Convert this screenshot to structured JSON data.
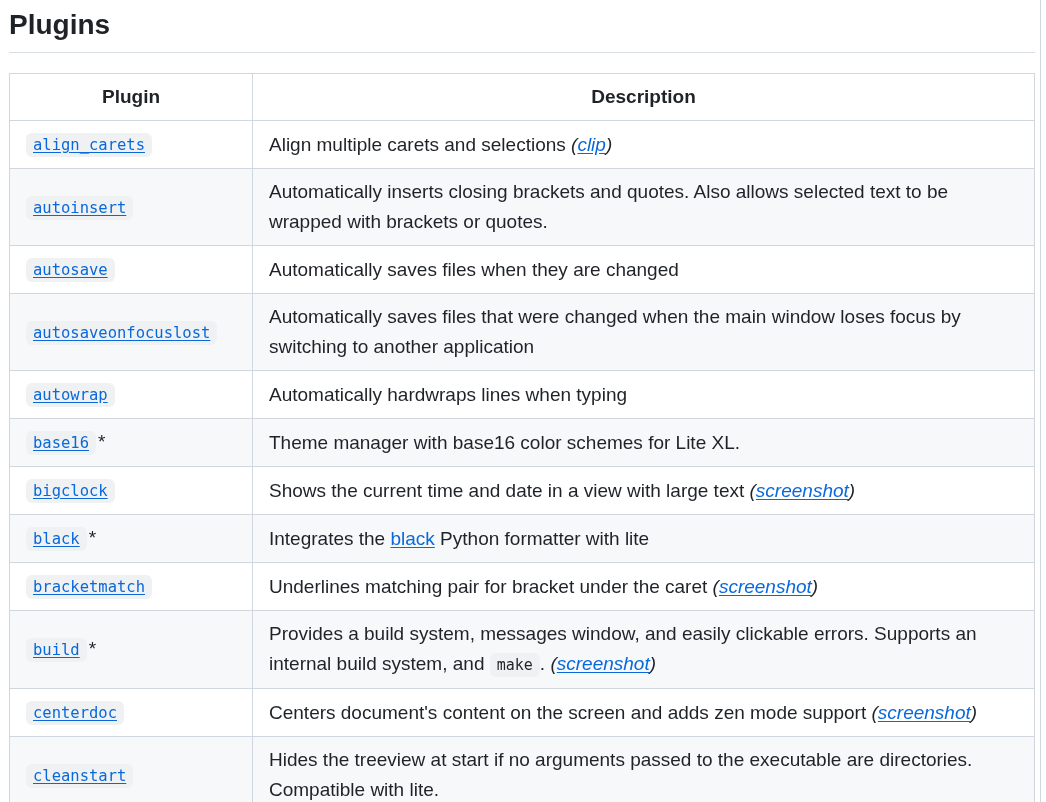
{
  "heading": "Plugins",
  "table": {
    "columns": [
      "Plugin",
      "Description"
    ],
    "rows": [
      {
        "plugin": [
          {
            "kind": "code_link",
            "text": "align_carets"
          }
        ],
        "description": [
          {
            "kind": "text",
            "text": "Align multiple carets and selections *(*"
          },
          {
            "kind": "link",
            "text": "clip",
            "italic": true
          },
          {
            "kind": "text",
            "text": "*)*"
          }
        ]
      },
      {
        "plugin": [
          {
            "kind": "code_link",
            "text": "autoinsert"
          }
        ],
        "description": [
          {
            "kind": "text",
            "text": "Automatically inserts closing brackets and quotes. Also allows selected text to be wrapped with brackets or quotes."
          }
        ]
      },
      {
        "plugin": [
          {
            "kind": "code_link",
            "text": "autosave"
          }
        ],
        "description": [
          {
            "kind": "text",
            "text": "Automatically saves files when they are changed"
          }
        ]
      },
      {
        "plugin": [
          {
            "kind": "code_link",
            "text": "autosaveonfocuslost"
          }
        ],
        "description": [
          {
            "kind": "text",
            "text": "Automatically saves files that were changed when the main window loses focus by switching to another application"
          }
        ]
      },
      {
        "plugin": [
          {
            "kind": "code_link",
            "text": "autowrap"
          }
        ],
        "description": [
          {
            "kind": "text",
            "text": "Automatically hardwraps lines when typing"
          }
        ]
      },
      {
        "plugin": [
          {
            "kind": "code_link",
            "text": "base16"
          },
          {
            "kind": "text",
            "text": "*"
          }
        ],
        "description": [
          {
            "kind": "text",
            "text": "Theme manager with base16 color schemes for Lite XL."
          }
        ]
      },
      {
        "plugin": [
          {
            "kind": "code_link",
            "text": "bigclock"
          }
        ],
        "description": [
          {
            "kind": "text",
            "text": "Shows the current time and date in a view with large text *(*"
          },
          {
            "kind": "link",
            "text": "screenshot",
            "italic": true
          },
          {
            "kind": "text",
            "text": "*)*"
          }
        ]
      },
      {
        "plugin": [
          {
            "kind": "code_link",
            "text": "black"
          },
          {
            "kind": "text",
            "text": "*"
          }
        ],
        "description": [
          {
            "kind": "text",
            "text": "Integrates the "
          },
          {
            "kind": "link",
            "text": "black",
            "italic": false
          },
          {
            "kind": "text",
            "text": " Python formatter with lite"
          }
        ]
      },
      {
        "plugin": [
          {
            "kind": "code_link",
            "text": "bracketmatch"
          }
        ],
        "description": [
          {
            "kind": "text",
            "text": "Underlines matching pair for bracket under the caret *(*"
          },
          {
            "kind": "link",
            "text": "screenshot",
            "italic": true
          },
          {
            "kind": "text",
            "text": "*)*"
          }
        ]
      },
      {
        "plugin": [
          {
            "kind": "code_link",
            "text": "build"
          },
          {
            "kind": "text",
            "text": "*"
          }
        ],
        "description": [
          {
            "kind": "text",
            "text": "Provides a build system, messages window, and easily clickable errors. Supports an internal build system, and "
          },
          {
            "kind": "code",
            "text": "make"
          },
          {
            "kind": "text",
            "text": ". *(*"
          },
          {
            "kind": "link",
            "text": "screenshot",
            "italic": true
          },
          {
            "kind": "text",
            "text": "*)*"
          }
        ]
      },
      {
        "plugin": [
          {
            "kind": "code_link",
            "text": "centerdoc"
          }
        ],
        "description": [
          {
            "kind": "text",
            "text": "Centers document's content on the screen and adds zen mode support *(*"
          },
          {
            "kind": "link",
            "text": "screenshot",
            "italic": true
          },
          {
            "kind": "text",
            "text": "*)*"
          }
        ]
      },
      {
        "plugin": [
          {
            "kind": "code_link",
            "text": "cleanstart"
          }
        ],
        "description": [
          {
            "kind": "text",
            "text": "Hides the treeview at start if no arguments passed to the executable are directories. Compatible with lite."
          }
        ]
      }
    ]
  }
}
